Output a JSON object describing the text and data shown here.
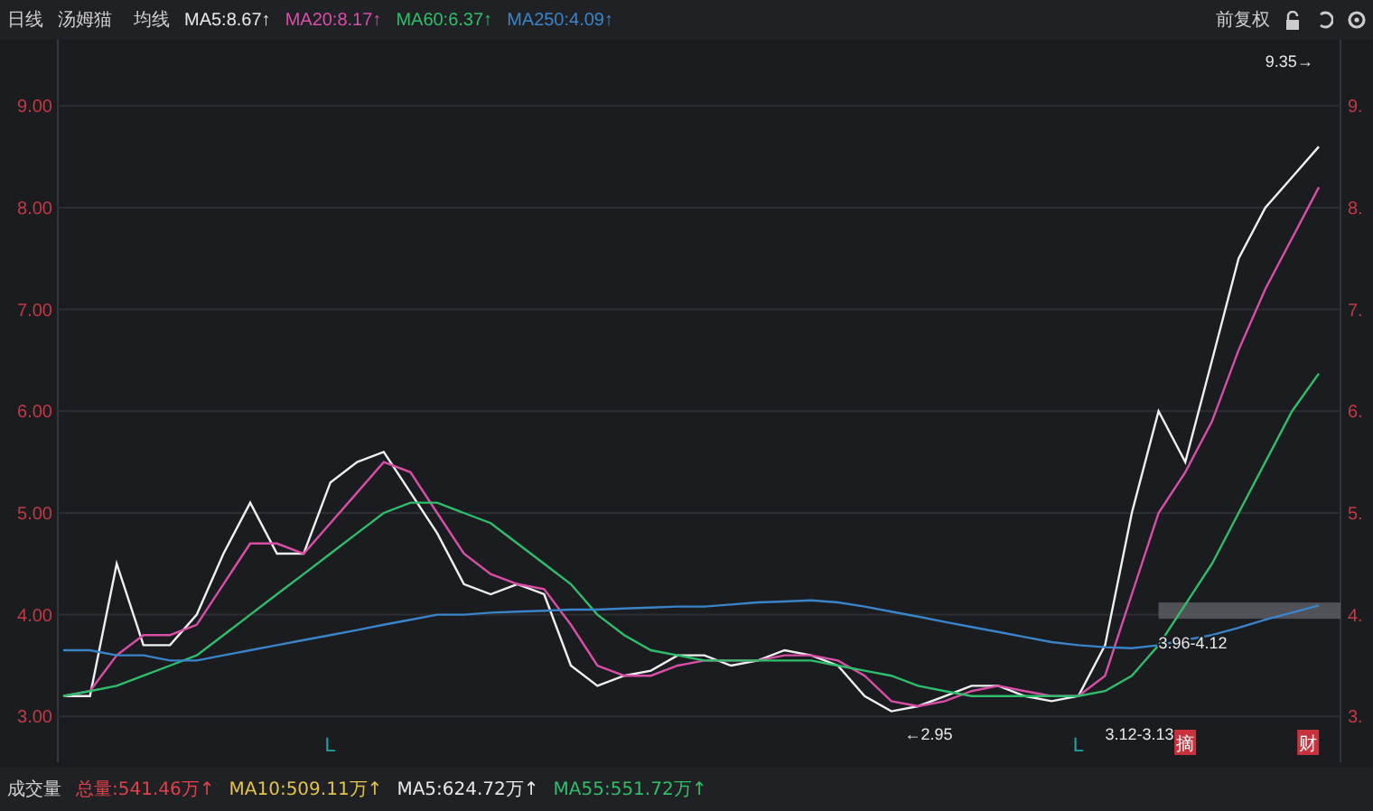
{
  "header": {
    "period": "日线",
    "name": "汤姆猫",
    "ma_label": "均线",
    "ma_items": [
      {
        "text": "MA5:8.67↑",
        "color": "#e8e8e8"
      },
      {
        "text": "MA20:8.17↑",
        "color": "#d94fa8"
      },
      {
        "text": "MA60:6.37↑",
        "color": "#2fbf6a"
      },
      {
        "text": "MA250:4.09↑",
        "color": "#3a84c9"
      }
    ],
    "adjust": "前复权"
  },
  "chart_data": {
    "type": "line",
    "grid": true,
    "yticks": [
      {
        "value": 3,
        "label": "3.00"
      },
      {
        "value": 4,
        "label": "4.00"
      },
      {
        "value": 5,
        "label": "5.00"
      },
      {
        "value": 6,
        "label": "6.00"
      },
      {
        "value": 7,
        "label": "7.00"
      },
      {
        "value": 8,
        "label": "8.00"
      },
      {
        "value": 9,
        "label": "9.00"
      }
    ],
    "ylim": [
      2.55,
      9.65
    ],
    "series": [
      {
        "color": "#f0f0f0",
        "values": [
          3.2,
          3.2,
          4.5,
          3.7,
          3.7,
          4.0,
          4.6,
          5.1,
          4.6,
          4.6,
          5.3,
          5.5,
          5.6,
          5.2,
          4.8,
          4.3,
          4.2,
          4.3,
          4.2,
          3.5,
          3.3,
          3.4,
          3.45,
          3.6,
          3.6,
          3.5,
          3.55,
          3.65,
          3.6,
          3.5,
          3.2,
          3.05,
          3.1,
          3.2,
          3.3,
          3.3,
          3.2,
          3.15,
          3.2,
          3.7,
          5.0,
          6.0,
          5.5,
          6.5,
          7.5,
          8.0,
          8.3,
          8.6
        ]
      },
      {
        "color": "#d94fa8",
        "values": [
          3.2,
          3.25,
          3.6,
          3.8,
          3.8,
          3.9,
          4.3,
          4.7,
          4.7,
          4.6,
          4.9,
          5.2,
          5.5,
          5.4,
          5.0,
          4.6,
          4.4,
          4.3,
          4.25,
          3.9,
          3.5,
          3.4,
          3.4,
          3.5,
          3.55,
          3.55,
          3.55,
          3.6,
          3.6,
          3.55,
          3.4,
          3.15,
          3.1,
          3.15,
          3.25,
          3.3,
          3.25,
          3.2,
          3.2,
          3.4,
          4.2,
          5.0,
          5.4,
          5.9,
          6.6,
          7.2,
          7.7,
          8.2
        ]
      },
      {
        "color": "#2fbf6a",
        "values": [
          3.2,
          3.25,
          3.3,
          3.4,
          3.5,
          3.6,
          3.8,
          4.0,
          4.2,
          4.4,
          4.6,
          4.8,
          5.0,
          5.1,
          5.1,
          5.0,
          4.9,
          4.7,
          4.5,
          4.3,
          4.0,
          3.8,
          3.65,
          3.6,
          3.55,
          3.55,
          3.55,
          3.55,
          3.55,
          3.5,
          3.45,
          3.4,
          3.3,
          3.25,
          3.2,
          3.2,
          3.2,
          3.2,
          3.2,
          3.25,
          3.4,
          3.7,
          4.1,
          4.5,
          5.0,
          5.5,
          6.0,
          6.37
        ]
      },
      {
        "color": "#3a84c9",
        "values": [
          3.65,
          3.65,
          3.6,
          3.6,
          3.55,
          3.55,
          3.6,
          3.65,
          3.7,
          3.75,
          3.8,
          3.85,
          3.9,
          3.95,
          4.0,
          4.0,
          4.02,
          4.03,
          4.04,
          4.05,
          4.05,
          4.06,
          4.07,
          4.08,
          4.08,
          4.1,
          4.12,
          4.13,
          4.14,
          4.12,
          4.08,
          4.03,
          3.98,
          3.93,
          3.88,
          3.83,
          3.78,
          3.73,
          3.7,
          3.68,
          3.67,
          3.7,
          3.75,
          3.8,
          3.87,
          3.95,
          4.02,
          4.09
        ]
      }
    ],
    "annotations": [
      "9.35→",
      "←2.95",
      "3.12-3.13",
      "3.96-4.12"
    ]
  },
  "right_axis_labels": [
    "9.",
    "8.",
    "7.",
    "6.",
    "5.",
    "4.",
    "3."
  ],
  "markers": [
    {
      "kind": "letter",
      "text": "L",
      "color": "#1fa5a0"
    },
    {
      "kind": "letter",
      "text": "L",
      "color": "#1fa5a0"
    },
    {
      "kind": "tag",
      "text": "摘",
      "color": "#c8323c"
    },
    {
      "kind": "tag",
      "text": "财",
      "color": "#c8323c"
    }
  ],
  "volume": {
    "label": "成交量",
    "items": [
      {
        "text": "总量:541.46万↑",
        "color": "#e0414a"
      },
      {
        "text": "MA10:509.11万↑",
        "color": "#e3c34a"
      },
      {
        "text": "MA5:624.72万↑",
        "color": "#e8e8e8"
      },
      {
        "text": "MA55:551.72万↑",
        "color": "#2fbf6a"
      }
    ]
  }
}
